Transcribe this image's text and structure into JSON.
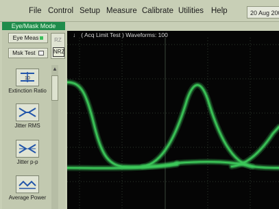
{
  "menu": {
    "items": [
      {
        "label": "File"
      },
      {
        "label": "Control"
      },
      {
        "label": "Setup"
      },
      {
        "label": "Measure"
      },
      {
        "label": "Calibrate"
      },
      {
        "label": "Utilities"
      },
      {
        "label": "Help"
      }
    ],
    "date": "20 Aug 200"
  },
  "mode_label": "Eye/Mask Mode",
  "buttons": {
    "eye_meas": "Eye Meas",
    "msk_test": "Msk Test",
    "rz": "RZ",
    "nrz": "NRZ"
  },
  "side_buttons": [
    {
      "label": "Extinction Ratio",
      "icon": "extinction-ratio-icon"
    },
    {
      "label": "Jitter RMS",
      "icon": "jitter-rms-icon"
    },
    {
      "label": "Jitter p-p",
      "icon": "jitter-pp-icon"
    },
    {
      "label": "Average Power",
      "icon": "average-power-icon"
    }
  ],
  "screen": {
    "status_text": "( Acq Limit Test )  Waveforms: 100",
    "trace_color": "#3cc85a",
    "grid_color": "#2f3a2f"
  }
}
